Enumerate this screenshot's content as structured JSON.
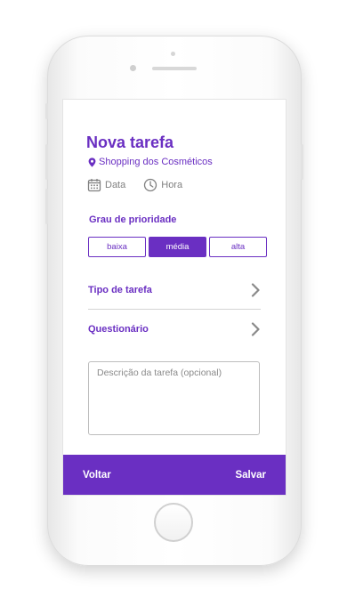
{
  "form": {
    "title": "Nova tarefa",
    "location": "Shopping dos Cosméticos",
    "date_label": "Data",
    "time_label": "Hora",
    "priority_label": "Grau de prioridade",
    "priority_options": [
      "baixa",
      "média",
      "alta"
    ],
    "priority_selected": "média",
    "task_type_label": "Tipo de tarefa",
    "questionnaire_label": "Questionário",
    "description_placeholder": "Descrição da tarefa (opcional)",
    "description_value": ""
  },
  "footer": {
    "back_label": "Voltar",
    "save_label": "Salvar"
  },
  "icons": {
    "location": "map-pin-icon",
    "date": "calendar-icon",
    "time": "clock-icon",
    "row_arrow": "chevron-right-icon"
  },
  "colors": {
    "accent": "#6a2fc2",
    "muted_text": "#808080",
    "divider": "#d4d4d4"
  }
}
